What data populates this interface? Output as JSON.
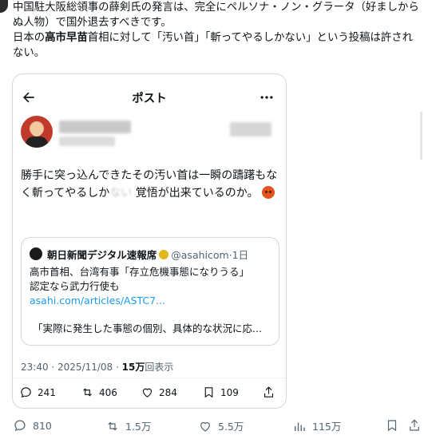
{
  "outer_post": {
    "line1": "中国駐大阪総領事の薛剣氏の発言は、完全にペルソナ・ノン・グラータ（好ましからぬ人物）で国外退去すべきです。",
    "line2_pre": "日本の",
    "line2_bold": "高市早苗",
    "line2_post": "首相に対して「汚い首」「斬ってやるしかない」という投稿は許されない。"
  },
  "screenshot": {
    "header_title": "ポスト",
    "post_text_1": "勝手に突っ込んできたその汚い首は一瞬の躊躇もなく斬ってやるしか",
    "post_text_blurred": "ない",
    "post_text_2": "覚悟が出来ているのか。",
    "quote": {
      "name": "朝日新聞デジタル速報席",
      "handle": "@asahicom",
      "time": "·1日",
      "line1": "高市首相、台湾有事「存立危機事態になりうる」",
      "line2": "認定なら武力行使も",
      "link": "asahi.com/articles/ASTC7...",
      "card_text": "「実際に発生した事態の個別、具体的な状況に応..."
    },
    "meta_time": "23:40 · 2025/11/08 · ",
    "meta_views_count": "15万",
    "meta_views_label": "回表示",
    "actions": {
      "replies": "241",
      "reposts": "406",
      "likes": "284",
      "bookmarks": "109"
    }
  },
  "outer_actions": {
    "replies": "810",
    "reposts": "1.5万",
    "likes": "5.5万",
    "views": "115万"
  },
  "icons": [
    "back-arrow-icon",
    "more-icon",
    "verified-badge-icon",
    "reply-icon",
    "repost-icon",
    "like-icon",
    "bookmark-icon",
    "share-icon",
    "views-icon"
  ],
  "colors": {
    "link": "#1d9bf0",
    "muted": "#536471",
    "verified": "#e2b719"
  }
}
